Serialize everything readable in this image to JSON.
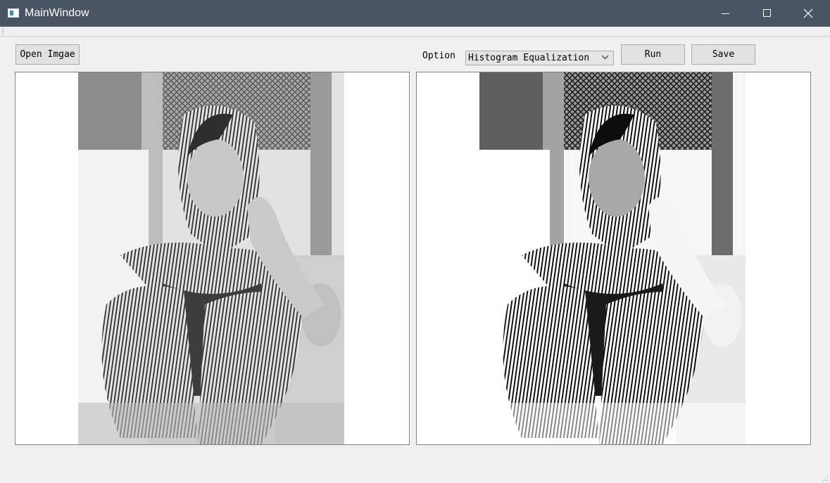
{
  "window": {
    "title": "MainWindow",
    "icons": {
      "app": "app-window-icon",
      "minimize": "minimize-icon",
      "maximize": "maximize-icon",
      "close": "close-icon"
    }
  },
  "toolbar": {
    "open_label": "Open Imgae",
    "option_label": "Option",
    "option_selected": "Histogram Equalization",
    "run_label": "Run",
    "save_label": "Save"
  },
  "panels": {
    "left": {
      "kind": "original-image"
    },
    "right": {
      "kind": "processed-image"
    }
  },
  "colors": {
    "titlebar": "#4a5563",
    "background": "#f0f0f0",
    "button": "#e1e1e1",
    "border": "#adadad"
  }
}
